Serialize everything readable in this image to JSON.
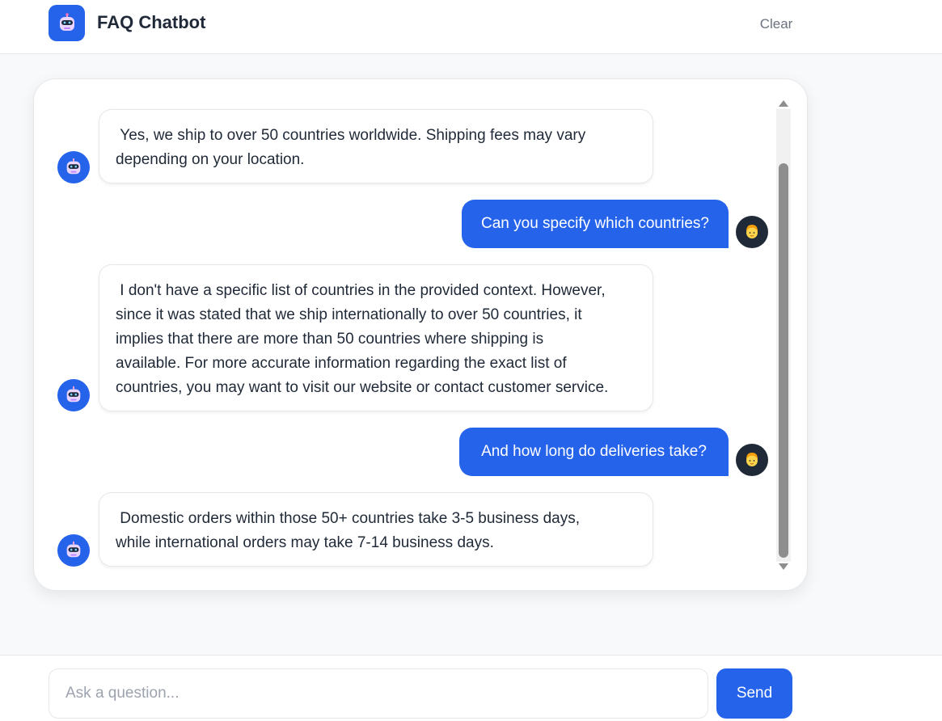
{
  "header": {
    "title": "FAQ Chatbot",
    "clear_label": "Clear",
    "logo_icon": "robot-icon"
  },
  "messages": [
    {
      "role": "bot",
      "text": " Yes, we ship to over 50 countries worldwide. Shipping fees may vary\ndepending on your location."
    },
    {
      "role": "user",
      "text": "Can you specify which countries?"
    },
    {
      "role": "bot",
      "text": " I don't have a specific list of countries in the provided context. However,\nsince it was stated that we ship internationally to over 50 countries, it\nimplies that there are more than 50 countries where shipping is\navailable. For more accurate information regarding the exact list of\ncountries, you may want to visit our website or contact customer service."
    },
    {
      "role": "user",
      "text": "And how long do deliveries take?"
    },
    {
      "role": "bot",
      "text": " Domestic orders within those 50+ countries take 3-5 business days,\nwhile international orders may take 7-14 business days."
    }
  ],
  "input": {
    "placeholder": "Ask a question...",
    "value": ""
  },
  "send_label": "Send",
  "colors": {
    "accent": "#2563eb",
    "user_avatar_bg": "#1f2937",
    "bubble_border": "#e5e7eb"
  }
}
